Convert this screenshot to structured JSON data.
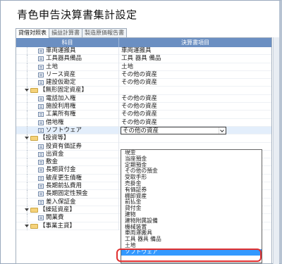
{
  "title": "青色申告決算書集計設定",
  "tabs": [
    "貸借対照表",
    "損益計算書",
    "製造原価報告書"
  ],
  "grid": {
    "col1_header": "科目",
    "col2_header": "決算書項目",
    "rows": [
      {
        "type": "item",
        "label": "車両運搬具",
        "value": "車両運搬具"
      },
      {
        "type": "item",
        "label": "工具器具備品",
        "value": "工具 器具 備品"
      },
      {
        "type": "item",
        "label": "土地",
        "value": "土地"
      },
      {
        "type": "item",
        "label": "リース資産",
        "value": "その他の資産"
      },
      {
        "type": "item",
        "label": "建設仮勘定",
        "value": "その他の資産"
      },
      {
        "type": "folder",
        "label": "【無形固定資産】",
        "value": ""
      },
      {
        "type": "item",
        "label": "電話加入権",
        "value": "その他の資産"
      },
      {
        "type": "item",
        "label": "施設利用権",
        "value": "その他の資産"
      },
      {
        "type": "item",
        "label": "工業所有権",
        "value": "その他の資産"
      },
      {
        "type": "item",
        "label": "借地権",
        "value": "その他の資産"
      },
      {
        "type": "item",
        "label": "ソフトウェア",
        "value": "その他の資産",
        "combo": true
      },
      {
        "type": "folder",
        "label": "【投資等】",
        "value": ""
      },
      {
        "type": "item",
        "label": "投資有価証券",
        "value": ""
      },
      {
        "type": "item",
        "label": "出資金",
        "value": ""
      },
      {
        "type": "item",
        "label": "敷金",
        "value": ""
      },
      {
        "type": "item",
        "label": "長期貸付金",
        "value": ""
      },
      {
        "type": "item",
        "label": "破産更生債権",
        "value": ""
      },
      {
        "type": "item",
        "label": "長期前払費用",
        "value": ""
      },
      {
        "type": "item",
        "label": "長期固定性預金",
        "value": ""
      },
      {
        "type": "item",
        "label": "差入保証金",
        "value": ""
      },
      {
        "type": "folder",
        "label": "【繰延資産】",
        "value": ""
      },
      {
        "type": "item",
        "label": "開業費",
        "value": ""
      },
      {
        "type": "folder",
        "label": "【事業主貸】",
        "value": ""
      }
    ]
  },
  "dropdown": {
    "options": [
      "現金",
      "当座預金",
      "定期預金",
      "その他の預金",
      "受取手形",
      "売掛金",
      "有価証券",
      "棚卸資産",
      "前払金",
      "貸付金",
      "建物",
      "建物附属設備",
      "機械装置",
      "車両運搬具",
      "工具 器具 備品",
      "土地",
      "ソフトウェア"
    ],
    "selected": "ソフトウェア"
  },
  "colors": {
    "header": "#6b8fc2",
    "highlight": "#3399ff",
    "ring": "#e03030"
  }
}
